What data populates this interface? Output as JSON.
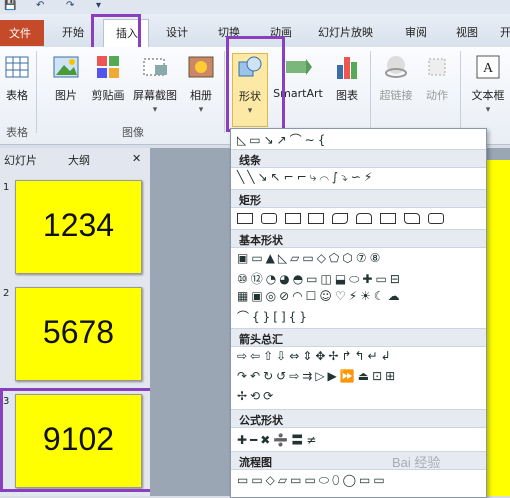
{
  "quick_access": {
    "save_icon": "save-icon",
    "undo_icon": "undo-icon",
    "redo_icon": "redo-icon"
  },
  "tabs": {
    "file": "文件",
    "home": "开始",
    "insert": "插入",
    "design": "设计",
    "transitions": "切换",
    "animations": "动画",
    "slideshow": "幻灯片放映",
    "review": "审阅",
    "view": "视图",
    "more": "开"
  },
  "ribbon": {
    "table": "表格",
    "picture": "图片",
    "clipart": "剪贴画",
    "screenshot": "屏幕截图",
    "album": "相册",
    "shapes": "形状",
    "smartart": "SmartArt",
    "chart": "图表",
    "hyperlink": "超链接",
    "action": "动作",
    "textbox": "文本框",
    "group_tables": "表格",
    "group_images": "图像"
  },
  "panel": {
    "tab_slides": "幻灯片",
    "tab_outline": "大纲",
    "close": "✕",
    "slides": [
      {
        "num": "1",
        "text": "1234"
      },
      {
        "num": "2",
        "text": "5678"
      },
      {
        "num": "3",
        "text": "9102"
      }
    ]
  },
  "shapes_menu": {
    "lines": "线条",
    "rectangles": "矩形",
    "basic": "基本形状",
    "arrows": "箭头总汇",
    "equation": "公式形状",
    "flowchart": "流程图",
    "recent_row": "◺▭↘↗⌒∼{",
    "lines_row": "╲╲↘↖⌐⌐⤷⌒∫⤵∽⚡",
    "basic_row1": "▣▭▲◺▱▭◇⬠⬡⑦⑧",
    "basic_row2": "⑩⑫◔◕◓▭◫⬓⬭✚▭⊟",
    "basic_row3": "▦▣◎⊘◠☐☺♡⚡☀☾☁",
    "basic_row4": "⌒{}[]{}",
    "arrows_row1": "⇨⇦⇧⇩⇔⇕✥✢↱↰↵↲",
    "arrows_row2": "↷↶↻↺⇨⇉▷▶⏩⏏⊡⊞",
    "arrows_row3": "✢⟲⟳",
    "equation_row": "✚━✖➗〓≠",
    "flowchart_row": "▭▭◇▱▭▭⬭⬯◯▭▭"
  },
  "watermark": "Bai 经验"
}
